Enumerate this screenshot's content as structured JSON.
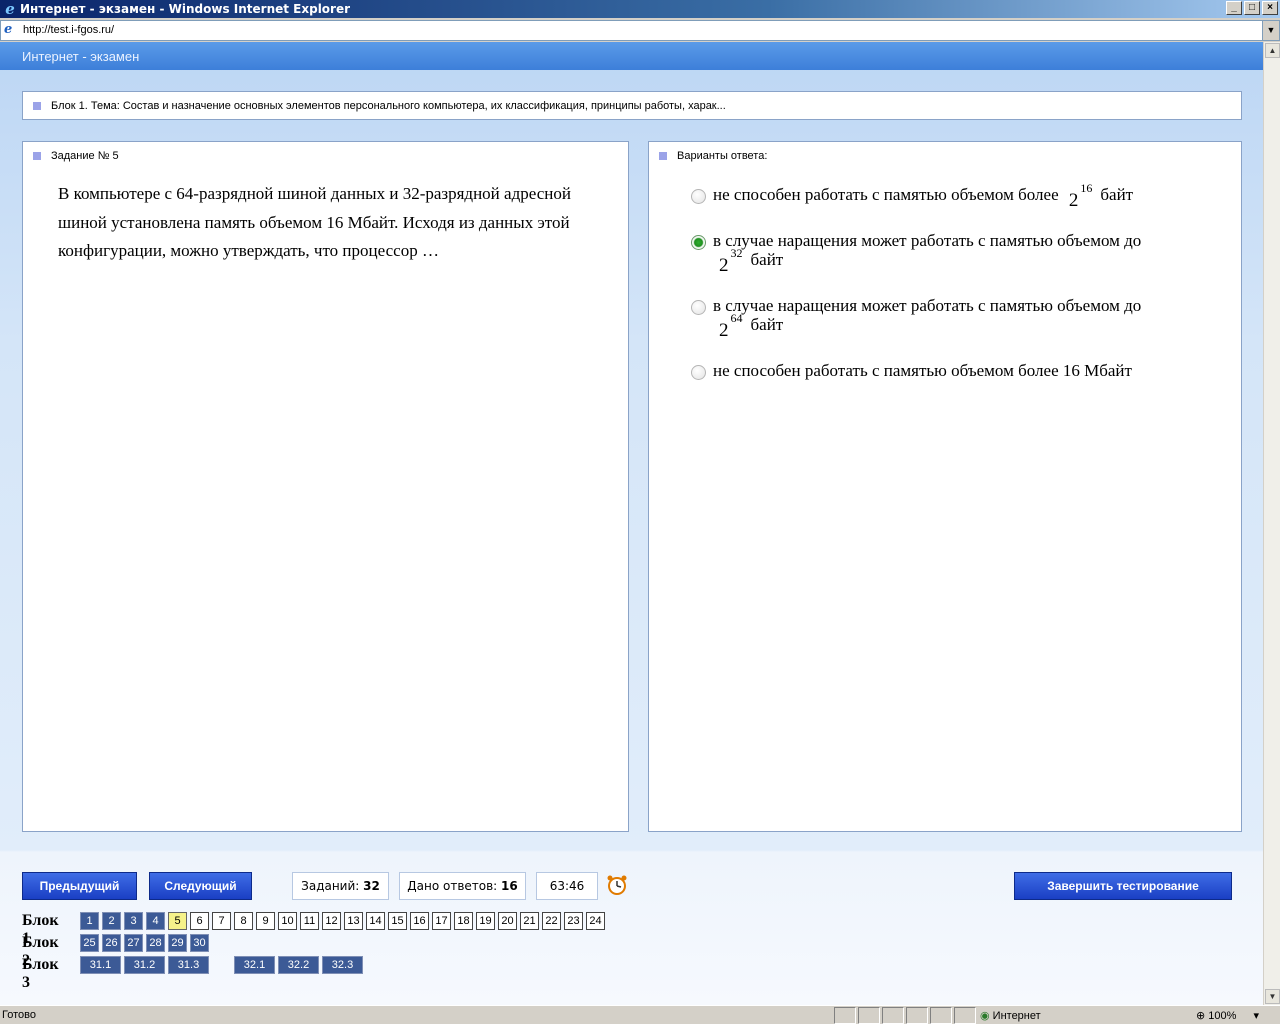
{
  "window": {
    "title": "Интернет - экзамен - Windows Internet Explorer",
    "url": "http://test.i-fgos.ru/"
  },
  "app": {
    "header": "Интернет - экзамен",
    "block_title": "Блок 1. Тема: Состав и назначение основных элементов персонального компьютера, их классификация, принципы работы, харак..."
  },
  "task": {
    "heading": "Задание № 5",
    "text": "В компьютере с 64-разрядной шиной данных и 32-разрядной адресной шиной установлена память объемом 16 Мбайт. Исходя из данных этой конфигурации, можно утверждать, что процессор …"
  },
  "answers": {
    "heading": "Варианты ответа:",
    "items": [
      {
        "text": "не способен работать с памятью объемом более",
        "base": "2",
        "exp": "16",
        "unit": "байт",
        "selected": false
      },
      {
        "text": "в случае наращения может работать с памятью объемом до",
        "base": "2",
        "exp": "32",
        "unit": "байт",
        "selected": true
      },
      {
        "text": "в случае наращения может работать с памятью объемом до",
        "base": "2",
        "exp": "64",
        "unit": "байт",
        "selected": false
      },
      {
        "text": "не способен работать с памятью объемом более 16 Мбайт",
        "selected": false
      }
    ]
  },
  "footer": {
    "prev_label": "Предыдущий",
    "next_label": "Следующий",
    "tasks_label": "Заданий:",
    "tasks_value": "32",
    "answered_label": "Дано ответов:",
    "answered_value": "16",
    "timer": "63:46",
    "finish_label": "Завершить тестирование"
  },
  "blocks": [
    {
      "label": "Блок 1",
      "items": [
        {
          "n": "1",
          "s": "ans"
        },
        {
          "n": "2",
          "s": "ans"
        },
        {
          "n": "3",
          "s": "ans"
        },
        {
          "n": "4",
          "s": "ans"
        },
        {
          "n": "5",
          "s": "cur"
        },
        {
          "n": "6",
          "s": "empty"
        },
        {
          "n": "7",
          "s": "empty"
        },
        {
          "n": "8",
          "s": "empty"
        },
        {
          "n": "9",
          "s": "empty"
        },
        {
          "n": "10",
          "s": "empty"
        },
        {
          "n": "11",
          "s": "empty"
        },
        {
          "n": "12",
          "s": "empty"
        },
        {
          "n": "13",
          "s": "empty"
        },
        {
          "n": "14",
          "s": "empty"
        },
        {
          "n": "15",
          "s": "empty"
        },
        {
          "n": "16",
          "s": "empty"
        },
        {
          "n": "17",
          "s": "empty"
        },
        {
          "n": "18",
          "s": "empty"
        },
        {
          "n": "19",
          "s": "empty"
        },
        {
          "n": "20",
          "s": "empty"
        },
        {
          "n": "21",
          "s": "empty"
        },
        {
          "n": "22",
          "s": "empty"
        },
        {
          "n": "23",
          "s": "empty"
        },
        {
          "n": "24",
          "s": "empty"
        }
      ]
    },
    {
      "label": "Блок 2",
      "items": [
        {
          "n": "25",
          "s": "ans"
        },
        {
          "n": "26",
          "s": "ans"
        },
        {
          "n": "27",
          "s": "ans"
        },
        {
          "n": "28",
          "s": "ans"
        },
        {
          "n": "29",
          "s": "ans"
        },
        {
          "n": "30",
          "s": "ans"
        }
      ]
    },
    {
      "label": "Блок 3",
      "items": [
        {
          "n": "31.1",
          "s": "ans"
        },
        {
          "n": "31.2",
          "s": "ans"
        },
        {
          "n": "31.3",
          "s": "ans"
        },
        {
          "n": "32.1",
          "s": "ans"
        },
        {
          "n": "32.2",
          "s": "ans"
        },
        {
          "n": "32.3",
          "s": "ans"
        }
      ]
    }
  ],
  "statusbar": {
    "status": "Готово",
    "zone": "Интернет",
    "zoom": "100%"
  }
}
